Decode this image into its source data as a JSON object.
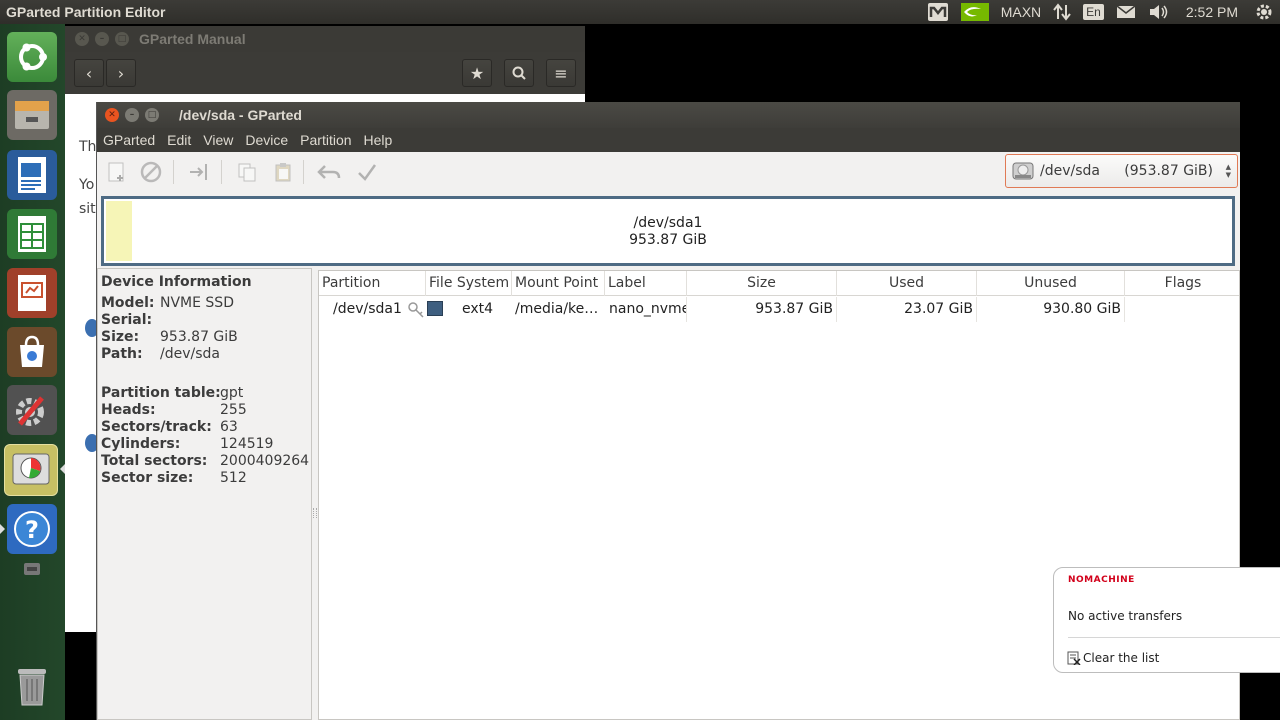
{
  "top_panel": {
    "app_title": "GParted Partition Editor",
    "power_mode": "MAXN",
    "keyboard_layout": "En",
    "clock": "2:52 PM"
  },
  "launcher": {
    "items": [
      "ubuntu-dash-icon",
      "files-icon",
      "writer-icon",
      "calc-icon",
      "impress-icon",
      "software-center-icon",
      "system-settings-icon",
      "gparted-icon",
      "help-icon",
      "drive-icon",
      "trash-icon"
    ]
  },
  "manual_window": {
    "title": "GParted Manual",
    "body_fragments": [
      "Th",
      "Yo",
      "sit"
    ]
  },
  "gparted": {
    "title": "/dev/sda - GParted",
    "menu": [
      "GParted",
      "Edit",
      "View",
      "Device",
      "Partition",
      "Help"
    ],
    "device_selector": {
      "name": "/dev/sda",
      "size": "(953.87 GiB)"
    },
    "disk_visual": {
      "partition": "/dev/sda1",
      "size": "953.87 GiB"
    },
    "device_info": {
      "heading": "Device Information",
      "rows": [
        {
          "label": "Model:",
          "value": "NVME SSD"
        },
        {
          "label": "Serial:",
          "value": ""
        },
        {
          "label": "Size:",
          "value": "953.87 GiB"
        },
        {
          "label": "Path:",
          "value": "/dev/sda"
        },
        {
          "label": "Partition table:",
          "value": "gpt"
        },
        {
          "label": "Heads:",
          "value": "255"
        },
        {
          "label": "Sectors/track:",
          "value": "63"
        },
        {
          "label": "Cylinders:",
          "value": "124519"
        },
        {
          "label": "Total sectors:",
          "value": "2000409264"
        },
        {
          "label": "Sector size:",
          "value": "512"
        }
      ]
    },
    "table": {
      "columns": [
        "Partition",
        "File System",
        "Mount Point",
        "Label",
        "Size",
        "Used",
        "Unused",
        "Flags"
      ],
      "rows": [
        {
          "partition": "/dev/sda1",
          "filesystem": "ext4",
          "fs_color": "#3f5f80",
          "mount_point": "/media/ke…",
          "label": "nano_nvme",
          "size": "953.87 GiB",
          "used": "23.07 GiB",
          "unused": "930.80 GiB",
          "flags": ""
        }
      ]
    }
  },
  "nomachine": {
    "brand": "NOMACHINE",
    "status": "No active transfers",
    "clear_label": "Clear the list"
  }
}
